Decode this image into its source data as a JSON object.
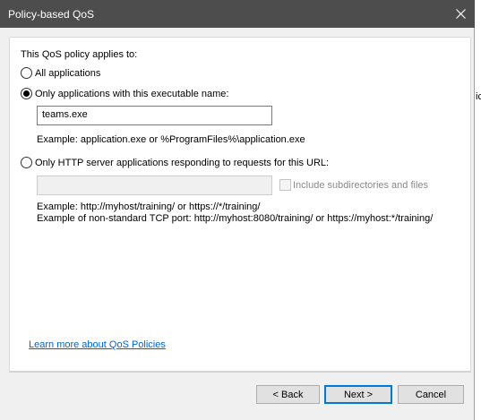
{
  "window": {
    "title": "Policy-based QoS"
  },
  "background_app": {
    "fragment_text": "ic"
  },
  "form": {
    "intro": "This QoS policy applies to:",
    "options": {
      "all_apps": "All applications",
      "exe_name": "Only applications with this executable name:",
      "http_url": "Only HTTP server applications responding to requests for this URL:"
    },
    "selected_option": "exe_name",
    "exe_input_value": "teams.exe",
    "exe_example": "Example:  application.exe or %ProgramFiles%\\application.exe",
    "url_input_value": "",
    "include_subdirs_label": "Include subdirectories and files",
    "include_subdirs_checked": false,
    "url_example_1": "Example:  http://myhost/training/ or https://*/training/",
    "url_example_2": "Example of non-standard TCP port:  http://myhost:8080/training/ or https://myhost:*/training/",
    "learn_more_link": "Learn more about QoS Policies"
  },
  "buttons": {
    "back": "< Back",
    "next": "Next >",
    "cancel": "Cancel"
  },
  "colors": {
    "titlebar": "#4d4d4d",
    "link": "#0066cc",
    "default_button_border": "#0078d7"
  }
}
